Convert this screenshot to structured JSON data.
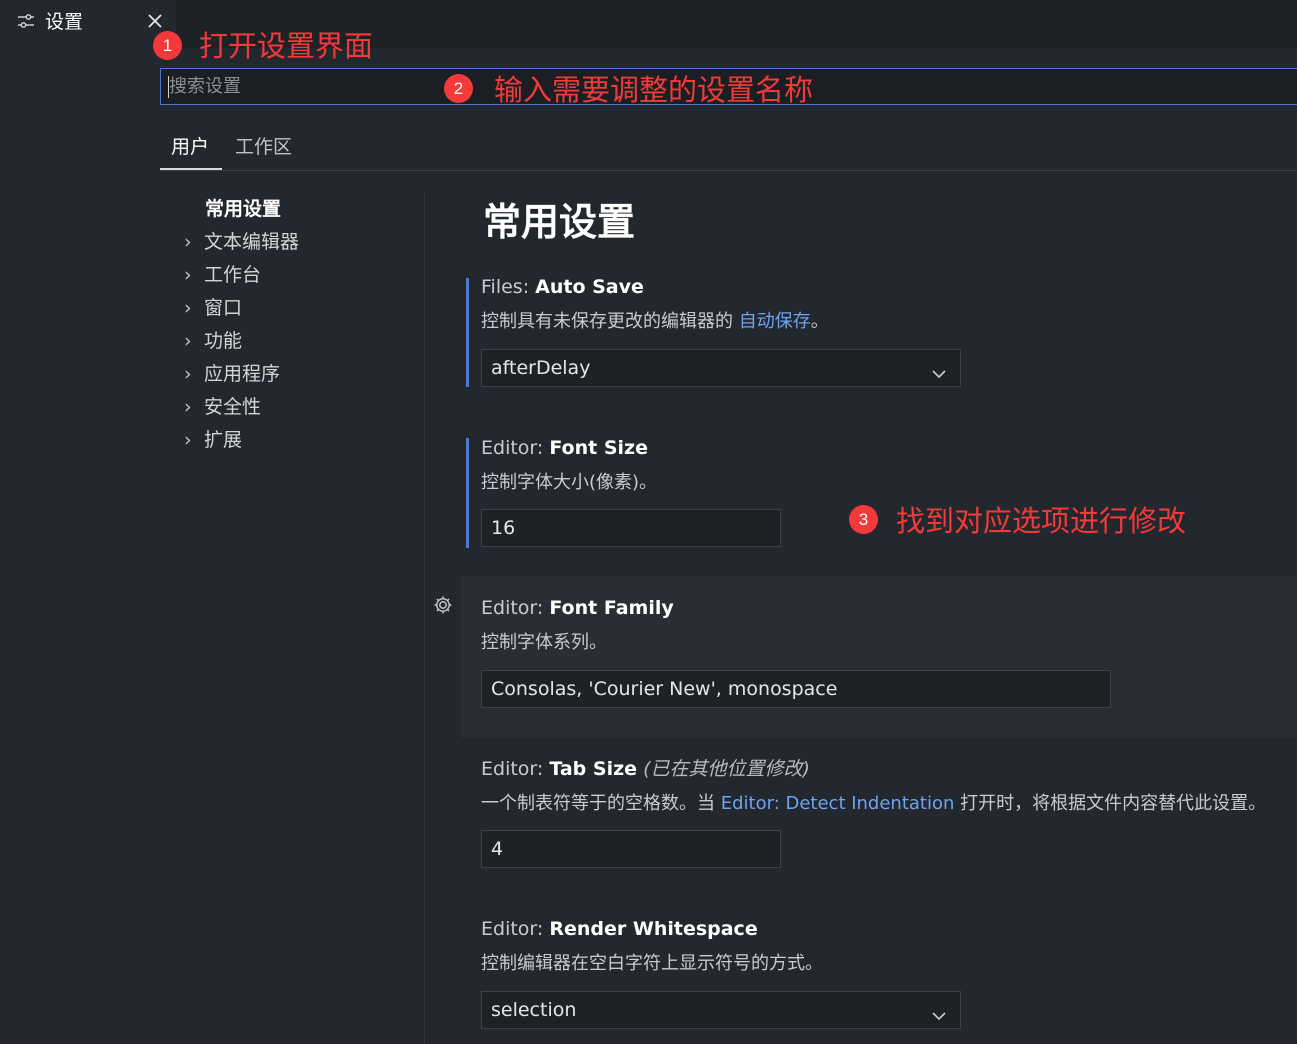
{
  "tab": {
    "icon": "settings-sliders-icon",
    "title": "设置",
    "close_icon": "close-icon"
  },
  "search": {
    "placeholder": "搜索设置",
    "value": ""
  },
  "scope_tabs": [
    {
      "label": "用户",
      "active": true
    },
    {
      "label": "工作区",
      "active": false
    }
  ],
  "toc": {
    "common": "常用设置",
    "items": [
      {
        "label": "文本编辑器"
      },
      {
        "label": "工作台"
      },
      {
        "label": "窗口"
      },
      {
        "label": "功能"
      },
      {
        "label": "应用程序"
      },
      {
        "label": "安全性"
      },
      {
        "label": "扩展"
      }
    ]
  },
  "section_title": "常用设置",
  "settings": [
    {
      "category": "Files: ",
      "name": "Auto Save",
      "desc_prefix": "控制具有未保存更改的编辑器的 ",
      "desc_link": "自动保存",
      "desc_suffix": "。",
      "value": "afterDelay",
      "control": "select"
    },
    {
      "category": "Editor: ",
      "name": "Font Size",
      "desc": "控制字体大小(像素)。",
      "value": "16",
      "control": "input"
    },
    {
      "category": "Editor: ",
      "name": "Font Family",
      "desc": "控制字体系列。",
      "value": "Consolas, 'Courier New', monospace",
      "control": "input"
    },
    {
      "category": "Editor: ",
      "name": "Tab Size",
      "modified_note": "(已在其他位置修改)",
      "desc_prefix": "一个制表符等于的空格数。当 ",
      "desc_link": "Editor: Detect Indentation",
      "desc_suffix": " 打开时，将根据文件内容替代此设置。",
      "value": "4",
      "control": "input"
    },
    {
      "category": "Editor: ",
      "name": "Render Whitespace",
      "desc": "控制编辑器在空白字符上显示符号的方式。",
      "value": "selection",
      "control": "select"
    }
  ],
  "annotations": [
    {
      "number": "1",
      "text": "打开设置界面"
    },
    {
      "number": "2",
      "text": "输入需要调整的设置名称"
    },
    {
      "number": "3",
      "text": "找到对应选项进行修改"
    }
  ],
  "colors": {
    "accent": "#4d78cc",
    "annotation": "#f23a3a",
    "link": "#6ea3f0",
    "background": "#23272e"
  }
}
